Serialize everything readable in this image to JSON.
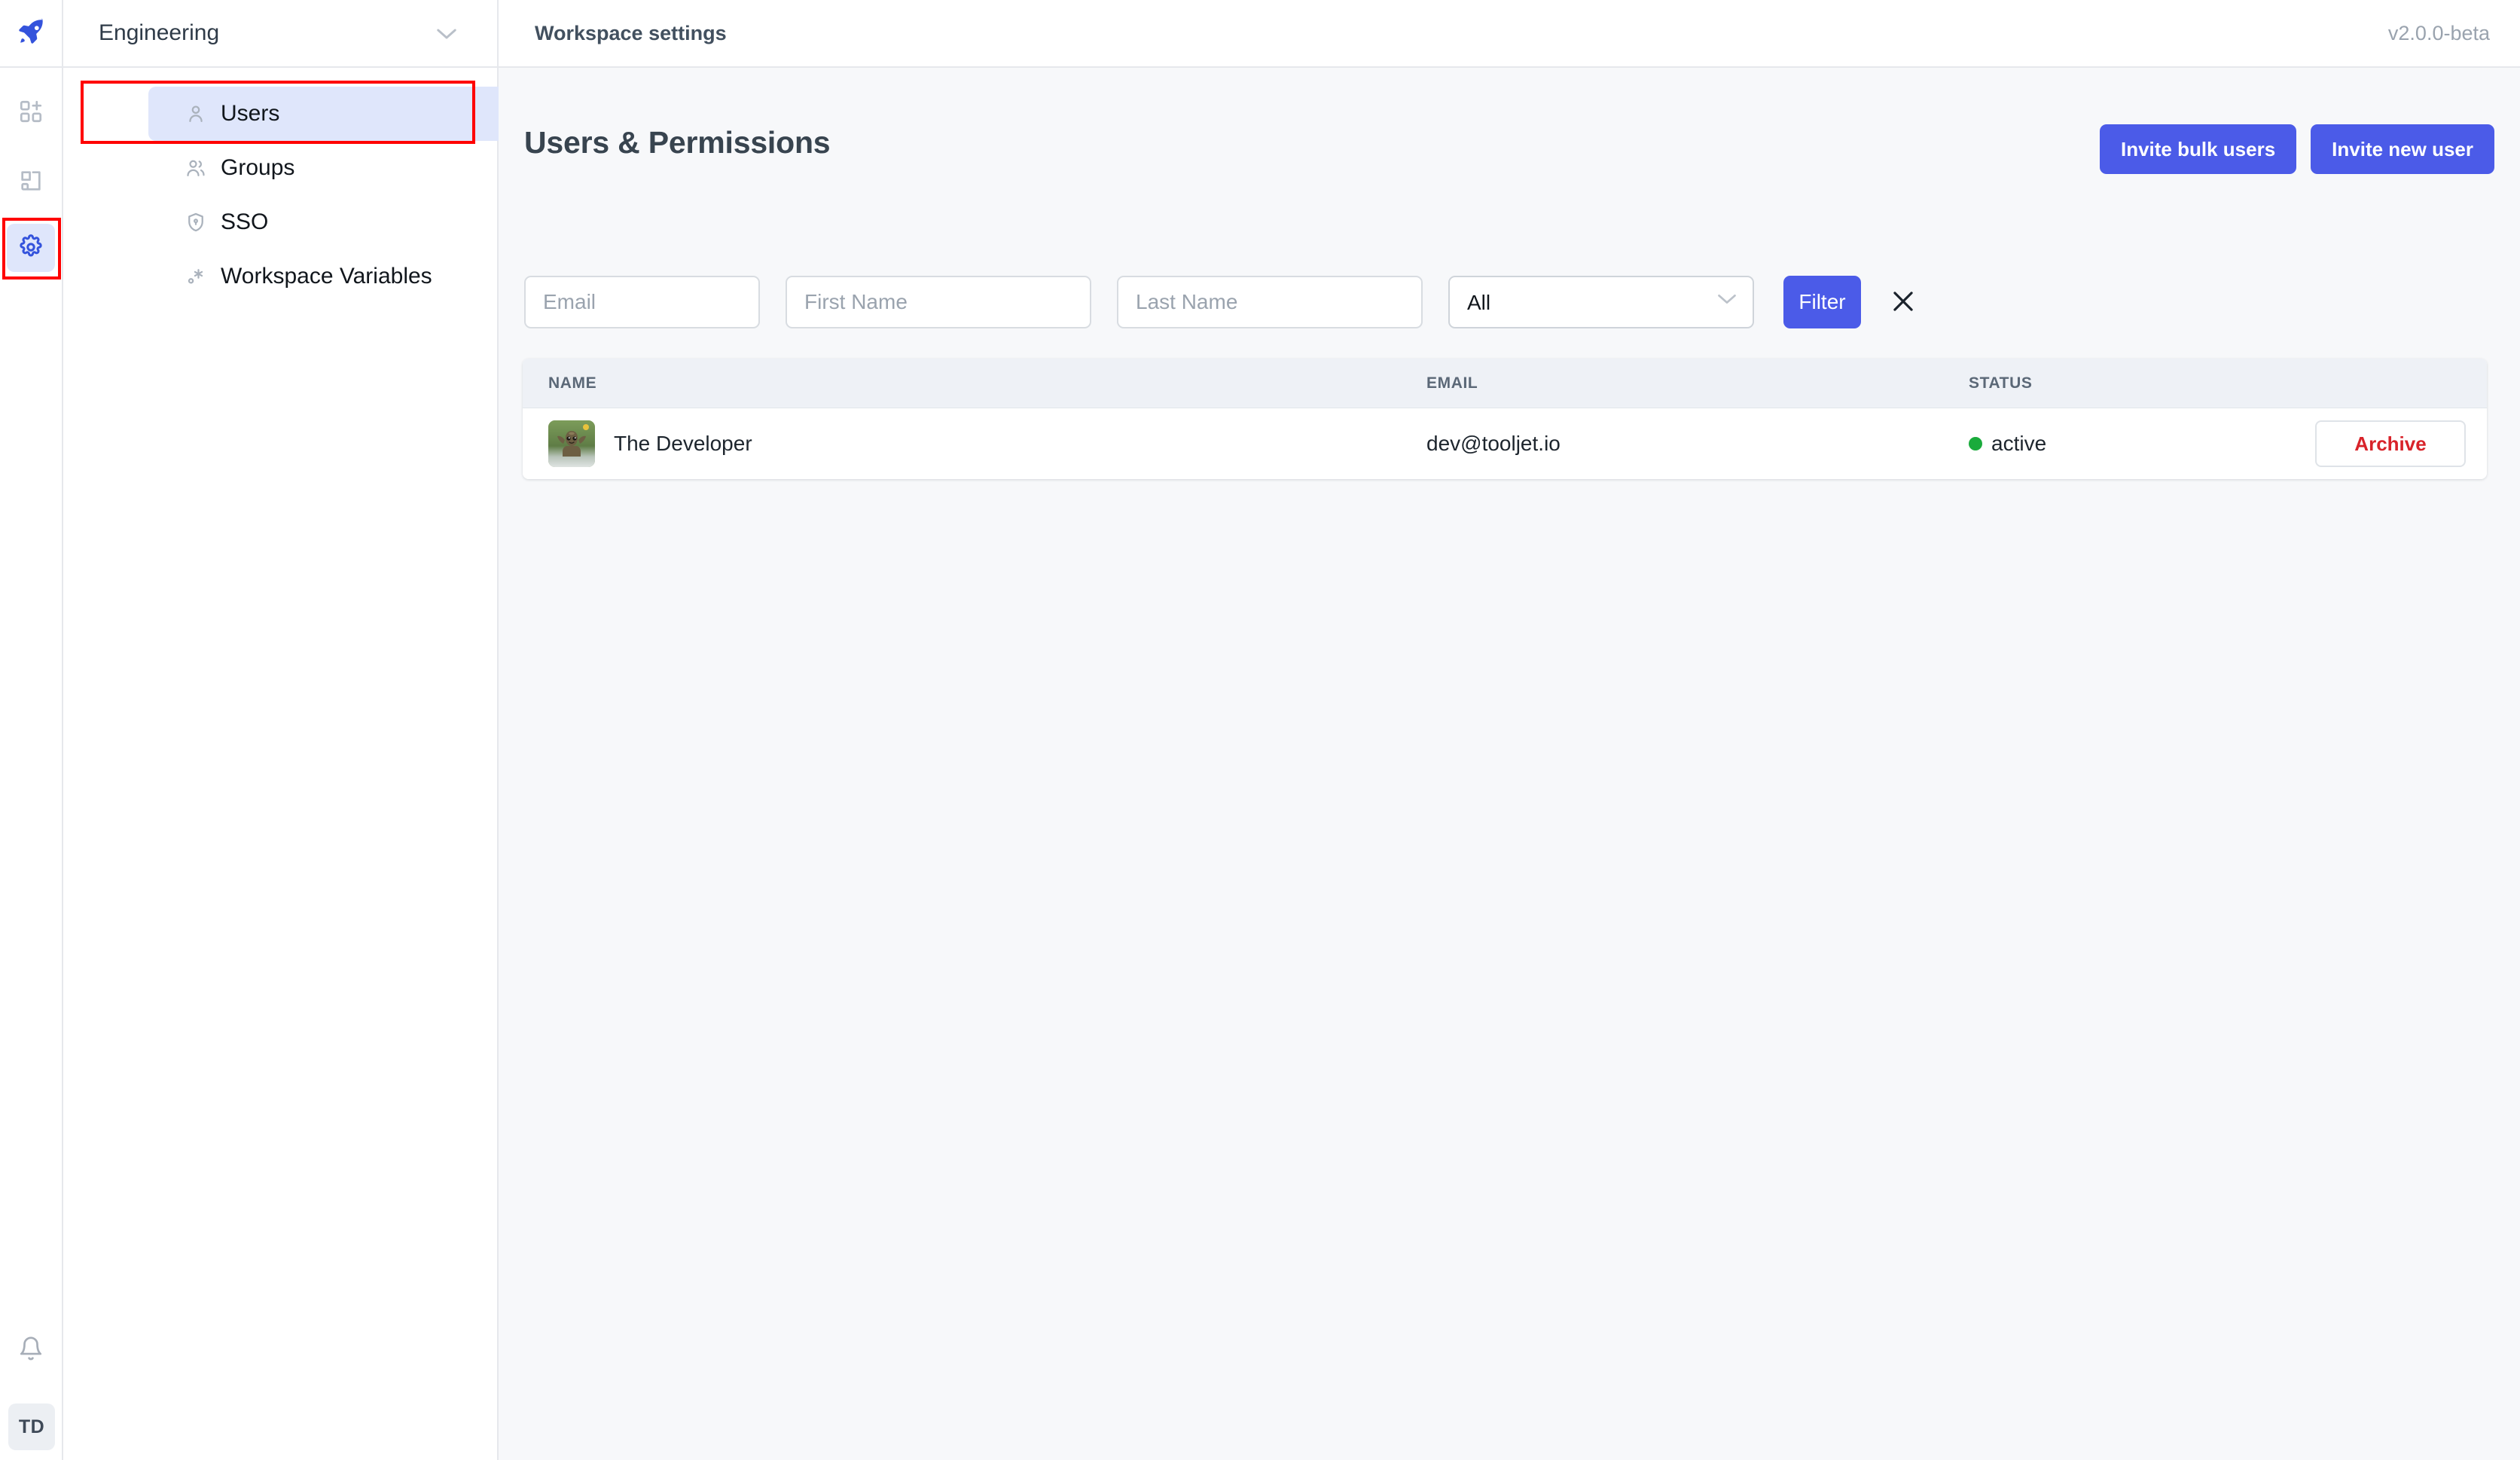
{
  "brand": {
    "logo_icon": "rocket-icon",
    "accent_color": "#4b5be8",
    "highlight_color": "#ff0000"
  },
  "icon_rail": {
    "items": [
      {
        "name": "add-app-icon",
        "icon": "grid-plus-icon",
        "active": false
      },
      {
        "name": "dashboard-icon",
        "icon": "layout-icon",
        "active": false
      },
      {
        "name": "settings-icon",
        "icon": "gear-icon",
        "active": true
      }
    ],
    "bell_icon": "bell-icon",
    "avatar_initials": "TD"
  },
  "workspace": {
    "name": "Engineering",
    "caret_icon": "chevron-down-icon"
  },
  "header": {
    "title": "Workspace settings",
    "version": "v2.0.0-beta"
  },
  "sidebar": {
    "items": [
      {
        "label": "Users",
        "icon": "user-icon",
        "active": true
      },
      {
        "label": "Groups",
        "icon": "users-icon",
        "active": false
      },
      {
        "label": "SSO",
        "icon": "shield-lock-icon",
        "active": false
      },
      {
        "label": "Workspace Variables",
        "icon": "variable-icon",
        "active": false
      }
    ]
  },
  "main": {
    "page_title": "Users & Permissions",
    "actions": {
      "invite_bulk_label": "Invite bulk users",
      "invite_new_label": "Invite new user"
    },
    "filters": {
      "email_placeholder": "Email",
      "email_value": "",
      "first_name_placeholder": "First Name",
      "first_name_value": "",
      "last_name_placeholder": "Last Name",
      "last_name_value": "",
      "role_selected": "All",
      "role_options": [
        "All"
      ],
      "filter_label": "Filter",
      "clear_icon": "close-icon",
      "caret_icon": "chevron-down-icon"
    },
    "table": {
      "columns": [
        "NAME",
        "EMAIL",
        "STATUS"
      ],
      "rows": [
        {
          "name": "The Developer",
          "email": "dev@tooljet.io",
          "status": "active",
          "status_color": "#1aab3c",
          "avatar_icon": "user-avatar-image",
          "action_label": "Archive"
        }
      ]
    }
  }
}
